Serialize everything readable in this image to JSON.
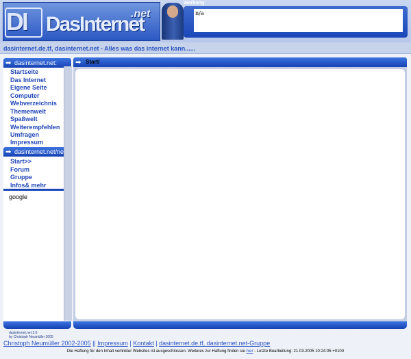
{
  "header": {
    "logo_di": "DI",
    "logo_name": "DasInternet",
    "logo_net": ".net",
    "werbung_label": "Werbung:",
    "werbung_text": "n/a"
  },
  "tagline": "dasinternet.de.tf, dasinternet.net - Alles was das internet kann......",
  "sidebar": {
    "section1_title": "dasinternet.net:",
    "section1_items": [
      "Startseite",
      "Das Internet",
      "Eigene Seite",
      "Computer",
      "Webverzeichnis",
      "Themenwelt",
      "Spaßwelt",
      "Weiterempfehlen",
      "Umfragen",
      "Impressum"
    ],
    "section2_title": "dasinternet.net/net",
    "section2_items": [
      "Start>>",
      "Forum",
      "Gruppe",
      "Infos& mehr"
    ],
    "google": "google"
  },
  "main": {
    "title": "Start/"
  },
  "footer": {
    "version": "dasinternet.net 2.0",
    "version_by": "by Christoph Neumüller 2005",
    "links": [
      "Christoph Neumüller 2002-2005",
      "Impressum",
      "Kontakt",
      "dasinternet.de.tf, dasinternet.net-Gruppe"
    ],
    "separator_1": "||",
    "separator": "|",
    "disclaimer_before": "Die Haftung für den Inhalt verlinkter Websites ist ausgeschlossen. Weiteres zur Haftung finden sie",
    "disclaimer_link": "hier",
    "disclaimer_after": "- Letzte Bearbeitung: 21.03.2005 10:24:05 +0100"
  },
  "colors": {
    "accent": "#1a47b8",
    "link": "#2146b8",
    "background": "#eef1f7"
  }
}
